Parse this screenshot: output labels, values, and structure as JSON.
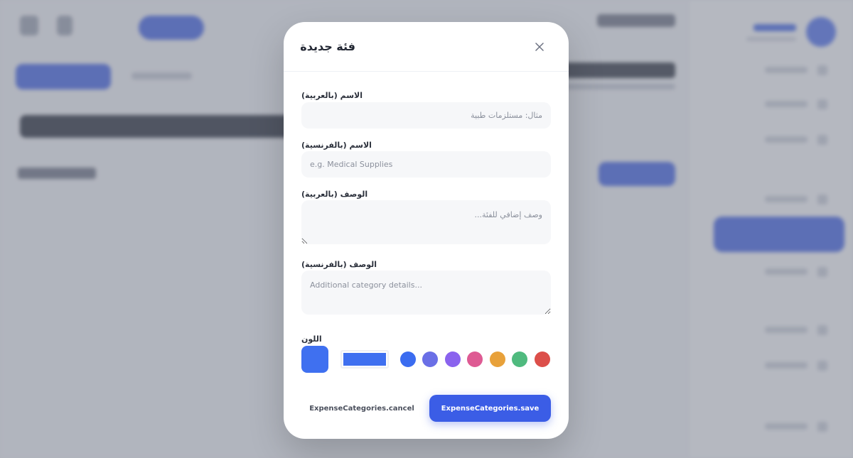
{
  "modal": {
    "title": "فئة جديدة",
    "close_icon": "close-icon",
    "fields": {
      "name_ar": {
        "label": "الاسم (بالعربية)",
        "placeholder": "مثال: مستلزمات طبية",
        "value": ""
      },
      "name_fr": {
        "label": "الاسم (بالفرنسية)",
        "placeholder": "e.g. Medical Supplies",
        "value": ""
      },
      "desc_ar": {
        "label": "الوصف (بالعربية)",
        "placeholder": "وصف إضافي للفئة...",
        "value": ""
      },
      "desc_fr": {
        "label": "الوصف (بالفرنسية)",
        "placeholder": "Additional category details...",
        "value": ""
      }
    },
    "color": {
      "label": "اللون",
      "selected": "#3f70f0",
      "swatches": [
        "#3b6cf0",
        "#6a6fe6",
        "#8a63ee",
        "#de5a93",
        "#e8a13a",
        "#4fba7e",
        "#dc4f4a"
      ]
    },
    "buttons": {
      "cancel_label": "ExpenseCategories.cancel",
      "save_label": "ExpenseCategories.save"
    }
  },
  "colors": {
    "accent": "#3b5de6",
    "overlay": "#787e8c"
  }
}
